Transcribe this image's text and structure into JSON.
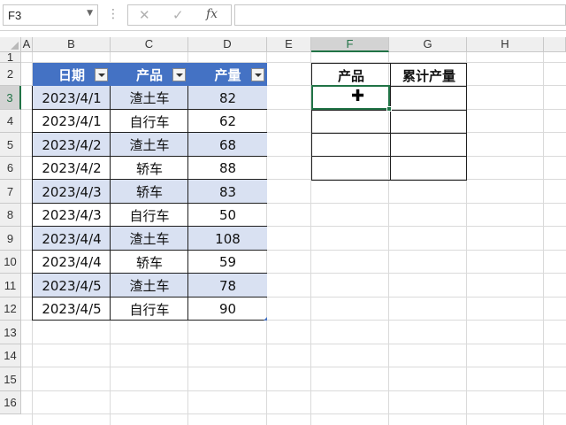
{
  "formula_bar": {
    "name_box": "F3",
    "cancel_icon": "✕",
    "enter_icon": "✓",
    "fx_label": "fx",
    "formula": ""
  },
  "columns": [
    "A",
    "B",
    "C",
    "D",
    "E",
    "F",
    "G",
    "H"
  ],
  "rows": [
    "1",
    "2",
    "3",
    "4",
    "5",
    "6",
    "7",
    "8",
    "9",
    "10",
    "11",
    "12",
    "13",
    "14",
    "15",
    "16"
  ],
  "active_cell": "F3",
  "table": {
    "headers": [
      "日期",
      "产品",
      "产量"
    ],
    "rows": [
      [
        "2023/4/1",
        "渣土车",
        "82"
      ],
      [
        "2023/4/1",
        "自行车",
        "62"
      ],
      [
        "2023/4/2",
        "渣土车",
        "68"
      ],
      [
        "2023/4/2",
        "轿车",
        "88"
      ],
      [
        "2023/4/3",
        "轿车",
        "83"
      ],
      [
        "2023/4/3",
        "自行车",
        "50"
      ],
      [
        "2023/4/4",
        "渣土车",
        "108"
      ],
      [
        "2023/4/4",
        "轿车",
        "59"
      ],
      [
        "2023/4/5",
        "渣土车",
        "78"
      ],
      [
        "2023/4/5",
        "自行车",
        "90"
      ]
    ]
  },
  "result_table": {
    "headers": [
      "产品",
      "累计产量"
    ]
  },
  "colors": {
    "table_header": "#4472c4",
    "band": "#d9e1f2",
    "selection": "#217346"
  }
}
